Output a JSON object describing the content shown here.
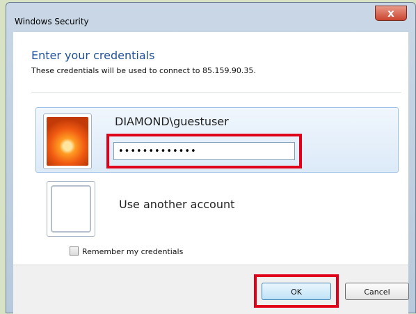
{
  "window": {
    "title": "Windows Security",
    "close_glyph": "x"
  },
  "dialog": {
    "heading": "Enter your credentials",
    "subtext": "These credentials will be used to connect to 85.159.90.35."
  },
  "account": {
    "username": "DIAMOND\\guestuser",
    "password_masked": "•••••••••••••"
  },
  "other_account": {
    "label": "Use another account"
  },
  "remember": {
    "label": "Remember my credentials",
    "checked": false
  },
  "buttons": {
    "ok": "OK",
    "cancel": "Cancel"
  },
  "icons": {
    "close": "close-icon",
    "user_avatar": "flower-avatar-icon",
    "other_avatar": "blank-avatar-icon"
  },
  "colors": {
    "highlight": "#e0001a",
    "heading": "#1e4f96"
  }
}
